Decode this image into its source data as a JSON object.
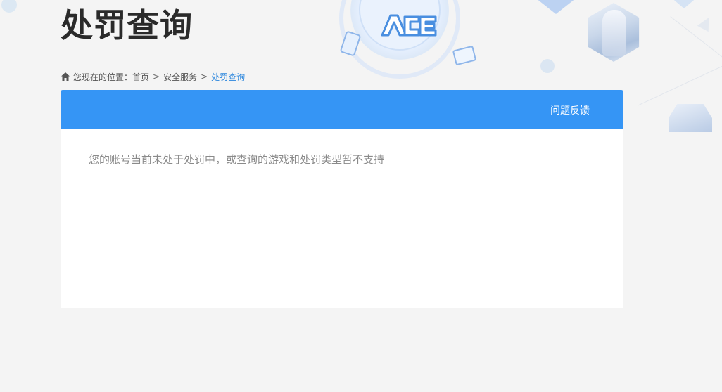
{
  "header": {
    "title": "处罚查询"
  },
  "breadcrumb": {
    "prefix": "您现在的位置：",
    "items": [
      "首页",
      "安全服务"
    ],
    "current": "处罚查询",
    "separator": ">"
  },
  "panel": {
    "feedback_label": "问题反馈",
    "message": "您的账号当前未处于处罚中，或查询的游戏和处罚类型暂不支持"
  },
  "icons": {
    "home": "home-icon",
    "logo": "ace-logo"
  },
  "colors": {
    "accent": "#3595f5",
    "breadcrumb_current": "#2b86dd",
    "background": "#f4f4f4"
  }
}
